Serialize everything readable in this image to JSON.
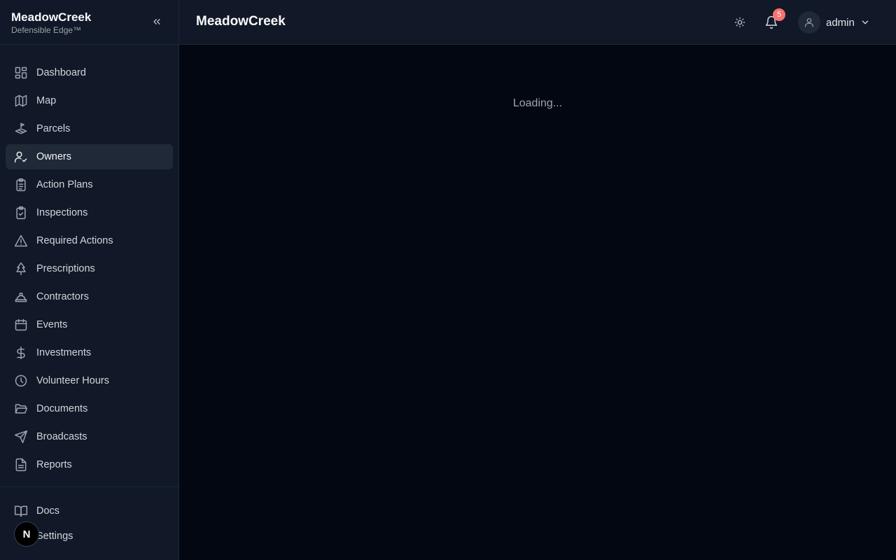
{
  "brand": {
    "name": "MeadowCreek",
    "tagline": "Defensible Edge™"
  },
  "sidebar": {
    "items": [
      {
        "label": "Dashboard",
        "icon": "dashboard-icon"
      },
      {
        "label": "Map",
        "icon": "map-icon"
      },
      {
        "label": "Parcels",
        "icon": "parcels-icon"
      },
      {
        "label": "Owners",
        "icon": "owners-icon",
        "active": true
      },
      {
        "label": "Action Plans",
        "icon": "clipboard-list-icon"
      },
      {
        "label": "Inspections",
        "icon": "clipboard-check-icon"
      },
      {
        "label": "Required Actions",
        "icon": "warning-triangle-icon"
      },
      {
        "label": "Prescriptions",
        "icon": "tree-icon"
      },
      {
        "label": "Contractors",
        "icon": "hard-hat-icon"
      },
      {
        "label": "Events",
        "icon": "calendar-icon"
      },
      {
        "label": "Investments",
        "icon": "dollar-icon"
      },
      {
        "label": "Volunteer Hours",
        "icon": "clock-icon"
      },
      {
        "label": "Documents",
        "icon": "folder-open-icon"
      },
      {
        "label": "Broadcasts",
        "icon": "send-icon"
      },
      {
        "label": "Reports",
        "icon": "file-text-icon"
      }
    ],
    "bottom_items": [
      {
        "label": "Docs",
        "icon": "book-icon"
      },
      {
        "label": "Settings",
        "icon": "gear-icon"
      }
    ],
    "floating_badge": "N"
  },
  "header": {
    "title": "MeadowCreek",
    "notification_count": "5",
    "user_name": "admin"
  },
  "main": {
    "status": "Loading..."
  },
  "colors": {
    "background": "#030712",
    "sidebar": "#111827",
    "active_item": "#1f2937",
    "notification_badge": "#f87171"
  }
}
